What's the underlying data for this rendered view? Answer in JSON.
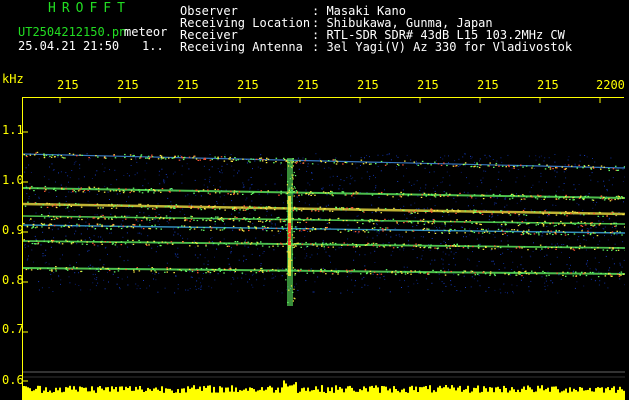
{
  "header": {
    "program_name": "HROFFT",
    "file_name": "UT2504212150.pn",
    "meteor_label": "meteor",
    "date_time": "25.04.21 21:50",
    "counter": "1.."
  },
  "station_info": [
    {
      "key": "Observer",
      "value": ": Masaki Kano"
    },
    {
      "key": "Receiving Location",
      "value": ": Shibukawa, Gunma, Japan"
    },
    {
      "key": "Receiver",
      "value": ": RTL-SDR SDR# 43dB L15 103.2MHz CW"
    },
    {
      "key": "Receiving Antenna",
      "value": ": 3el Yagi(V) Az 330 for Vladivostok"
    }
  ],
  "axis": {
    "unit_label": "kHz",
    "x_ticks": [
      "215",
      "215",
      "215",
      "215",
      "215",
      "215",
      "215",
      "215",
      "215",
      "2200"
    ],
    "y_ticks": [
      "1.1",
      "1.0",
      "0.9",
      "0.8",
      "0.7",
      "0.6"
    ]
  },
  "colors": {
    "axis": "#ffff00",
    "background": "#000000",
    "title": "#22dd22",
    "text": "#ffffff"
  }
}
